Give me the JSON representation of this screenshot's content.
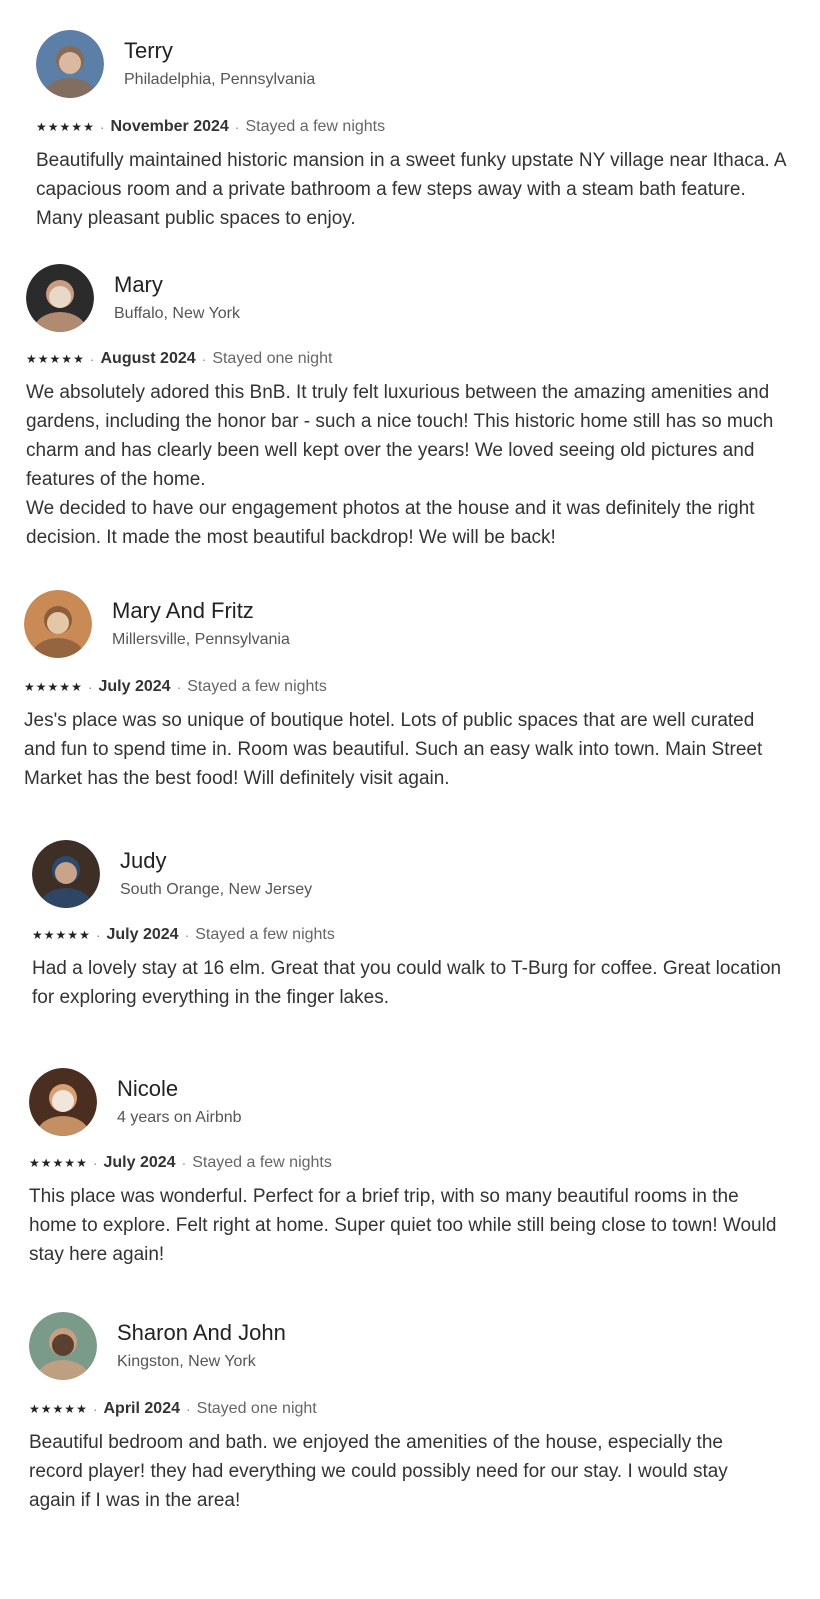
{
  "reviews": [
    {
      "name": "Terry",
      "subtitle": "Philadelphia, Pennsylvania",
      "rating": 5,
      "date": "November 2024",
      "stay": "Stayed a few nights",
      "text": "Beautifully maintained historic mansion in a sweet funky upstate NY village near Ithaca. A capacious room and a private bathroom a few steps away with a steam bath feature. Many pleasant public spaces to enjoy.",
      "avatar_colors": [
        "#5b7fa6",
        "#8a6a55",
        "#d9b9a0"
      ]
    },
    {
      "name": "Mary",
      "subtitle": "Buffalo, New York",
      "rating": 5,
      "date": "August 2024",
      "stay": "Stayed one night",
      "text": "We absolutely adored this BnB. It truly felt luxurious between the amazing amenities and gardens, including the honor bar - such a nice touch! This historic home still has so much charm and has clearly been well kept over the years! We loved seeing old pictures and features of the home.\nWe decided to have our engagement photos at the house and it was definitely the right decision. It made the most beautiful backdrop! We will be back!",
      "avatar_colors": [
        "#2b2b2b",
        "#c99b7f",
        "#e8d8c8"
      ]
    },
    {
      "name": "Mary And Fritz",
      "subtitle": "Millersville, Pennsylvania",
      "rating": 5,
      "date": "July 2024",
      "stay": "Stayed a few nights",
      "text": "Jes's place was so unique of boutique hotel. Lots of public spaces that are well curated and fun to spend time in. Room was beautiful. Such an easy walk into town. Main Street Market has the best food! Will definitely visit again.",
      "avatar_colors": [
        "#c98a55",
        "#8c5e3c",
        "#e6c7a5"
      ]
    },
    {
      "name": "Judy",
      "subtitle": "South Orange, New Jersey",
      "rating": 5,
      "date": "July 2024",
      "stay": "Stayed a few nights",
      "text": "Had a lovely stay at 16 elm. Great that you could walk to T-Burg for coffee. Great location for exploring everything in the finger lakes.",
      "avatar_colors": [
        "#3d2f25",
        "#2c4a6e",
        "#c9a488"
      ]
    },
    {
      "name": "Nicole",
      "subtitle": "4 years on Airbnb",
      "rating": 5,
      "date": "July 2024",
      "stay": "Stayed a few nights",
      "text": "This place was wonderful. Perfect for a brief trip, with so many beautiful rooms in the home to explore. Felt right at home. Super quiet too while still being close to town! Would stay here again!",
      "avatar_colors": [
        "#4a2e20",
        "#d8a070",
        "#f0e6dc"
      ]
    },
    {
      "name": "Sharon And John",
      "subtitle": "Kingston, New York",
      "rating": 5,
      "date": "April 2024",
      "stay": "Stayed one night",
      "text": "Beautiful bedroom and bath. we enjoyed the amenities of the house, especially the record player! they had everything we could possibly need for our stay. I would stay again if I was in the area!",
      "avatar_colors": [
        "#7a9a8a",
        "#c9a07f",
        "#5a4030"
      ]
    }
  ],
  "separator": "·",
  "star_glyph": "★"
}
